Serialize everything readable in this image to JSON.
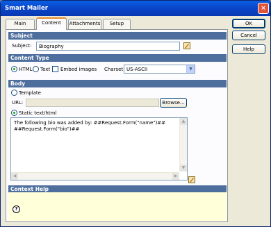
{
  "window": {
    "title": "Smart Mailer",
    "close_glyph": "×",
    "close_icon": "close-icon"
  },
  "tabs": [
    {
      "label": "Main"
    },
    {
      "label": "Content"
    },
    {
      "label": "Attachments"
    },
    {
      "label": "Setup"
    }
  ],
  "active_tab": "Content",
  "subject_section": {
    "header": "Subject",
    "label": "Subject:",
    "value": "Biography",
    "dynamic_icon": "lightning-edit-icon"
  },
  "content_type_section": {
    "header": "Content Type",
    "html_label": "HTML",
    "html_selected": true,
    "text_label": "Text",
    "text_selected": false,
    "embed_label": "Embed images",
    "embed_checked": false,
    "charset_label": "Charset:",
    "charset_value": "US-ASCII"
  },
  "body_section": {
    "header": "Body",
    "template_label": "Template",
    "template_selected": false,
    "url_label": "URL:",
    "url_value": "",
    "browse_label": "Browse...",
    "static_label": "Static text/html",
    "static_selected": true,
    "static_text": "The following bio was added by: ##Request.Form(\"name\")##\n##Request.Form(\"bio\")##"
  },
  "context_help": {
    "header": "Context Help",
    "icon_glyph": "?"
  },
  "buttons": {
    "ok": "OK",
    "cancel": "Cancel",
    "help": "Help"
  },
  "colors": {
    "section_header": "#4e6f9d",
    "titlebar": "#0a45c8",
    "help_background": "#ffffd9",
    "active_tab_accent": "#e68b2c"
  }
}
